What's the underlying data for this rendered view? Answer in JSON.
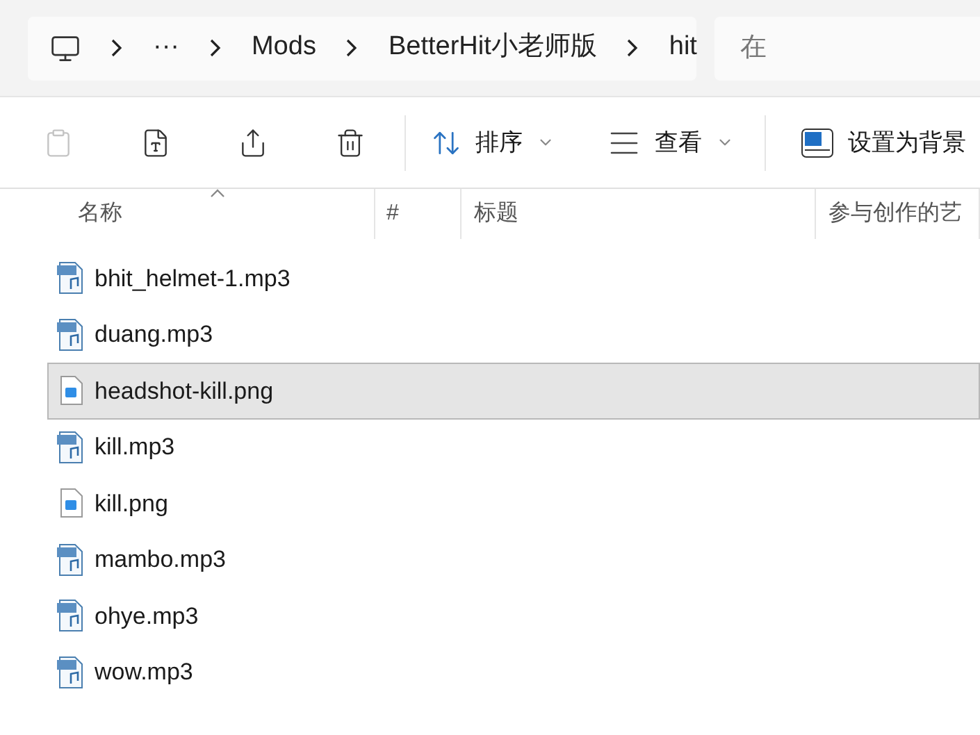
{
  "breadcrumb": {
    "items": [
      {
        "label": "···"
      },
      {
        "label": "Mods"
      },
      {
        "label": "BetterHit小老师版"
      },
      {
        "label": "hit"
      }
    ]
  },
  "search": {
    "placeholder": "在"
  },
  "toolbar": {
    "actions": [
      {
        "kind": "paste",
        "disabled": true
      },
      {
        "kind": "rename",
        "disabled": false
      },
      {
        "kind": "share",
        "disabled": false
      },
      {
        "kind": "delete",
        "disabled": false
      }
    ],
    "sort": {
      "label": "排序"
    },
    "view": {
      "label": "查看"
    },
    "background": {
      "label": "设置为背景"
    }
  },
  "columns": [
    {
      "label": "名称",
      "sorted": true
    },
    {
      "label": "#",
      "sorted": false
    },
    {
      "label": "标题",
      "sorted": false
    },
    {
      "label": "参与创作的艺",
      "sorted": false
    }
  ],
  "files": [
    {
      "name": "bhit_helmet-1.mp3",
      "kind": "mp3",
      "selected": false
    },
    {
      "name": "duang.mp3",
      "kind": "mp3",
      "selected": false
    },
    {
      "name": "headshot-kill.png",
      "kind": "png",
      "selected": true
    },
    {
      "name": "kill.mp3",
      "kind": "mp3",
      "selected": false
    },
    {
      "name": "kill.png",
      "kind": "png",
      "selected": false
    },
    {
      "name": "mambo.mp3",
      "kind": "mp3",
      "selected": false
    },
    {
      "name": "ohye.mp3",
      "kind": "mp3",
      "selected": false
    },
    {
      "name": "wow.mp3",
      "kind": "mp3",
      "selected": false
    }
  ]
}
